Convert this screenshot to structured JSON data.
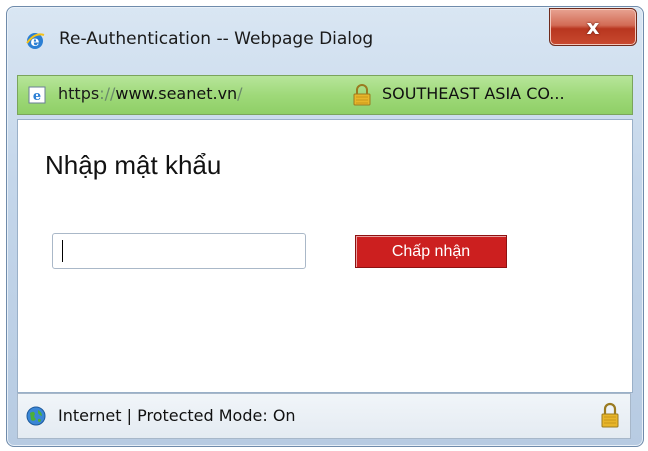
{
  "window": {
    "title": "Re-Authentication -- Webpage Dialog",
    "close_label": "x"
  },
  "address_bar": {
    "protocol": "https",
    "separator": "://",
    "host": "www.seanet.vn",
    "trailing": "/",
    "certificate_owner": "SOUTHEAST ASIA CO...",
    "bar_color": "#9fd97a"
  },
  "dialog": {
    "heading": "Nhập mật khẩu",
    "password": {
      "value": "",
      "placeholder": ""
    },
    "accept_label": "Chấp nhận",
    "accept_color": "#cc1f1f"
  },
  "status_bar": {
    "text": "Internet | Protected Mode: On",
    "zone_icon": "globe-icon",
    "security_icon": "lock-icon"
  }
}
